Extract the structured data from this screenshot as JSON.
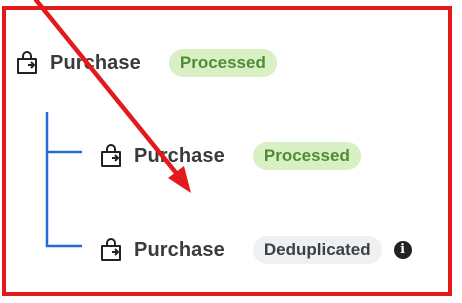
{
  "tree": {
    "root": {
      "label": "Purchase",
      "status": "Processed",
      "icon": "shopping-bag-icon"
    },
    "children": [
      {
        "label": "Purchase",
        "status": "Processed",
        "icon": "shopping-bag-icon"
      },
      {
        "label": "Purchase",
        "status": "Deduplicated",
        "icon": "shopping-bag-icon",
        "info_icon": "info-icon"
      }
    ]
  },
  "colors": {
    "frame": "#e3191b",
    "arrow": "#e3191b",
    "connector": "#1f6fd1",
    "processed_bg": "#d8f0c4",
    "processed_text": "#4e8e31",
    "dedup_bg": "#eef0f2"
  }
}
